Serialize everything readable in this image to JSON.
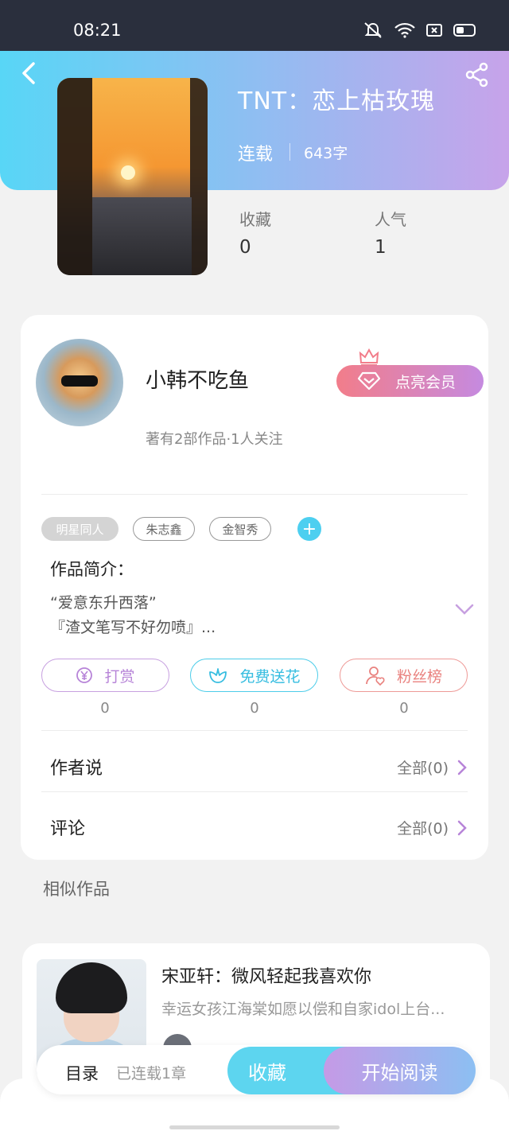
{
  "status_bar": {
    "time": "08:21"
  },
  "book": {
    "title": "TNT：恋上枯玫瑰",
    "status": "连载",
    "word_count": "643字",
    "stats": [
      {
        "label": "收藏",
        "value": "0"
      },
      {
        "label": "人气",
        "value": "1"
      }
    ]
  },
  "author": {
    "name": "小韩不吃鱼",
    "meta": "著有2部作品·1人关注",
    "vip_label": "点亮会员"
  },
  "tags": [
    "明星同人",
    "朱志鑫",
    "金智秀"
  ],
  "intro": {
    "title": "作品简介：",
    "lines": [
      "“爱意东升西落”",
      "『渣文笔写不好勿喷』..."
    ]
  },
  "actions": [
    {
      "label": "打赏",
      "count": "0"
    },
    {
      "label": "免费送花",
      "count": "0"
    },
    {
      "label": "粉丝榜",
      "count": "0"
    }
  ],
  "rows": [
    {
      "label": "作者说",
      "link": "全部(0)"
    },
    {
      "label": "评论",
      "link": "全部(0)"
    }
  ],
  "similar": {
    "title": "相似作品",
    "items": [
      {
        "title": "宋亚轩：微风轻起我喜欢你",
        "desc": "幸运女孩江海棠如愿以偿和自家idol上台..."
      }
    ]
  },
  "bottom": {
    "toc": "目录",
    "chapters": "已连载1章",
    "collect": "收藏",
    "read": "开始阅读"
  },
  "colors": {
    "header_start": "#58d6f6",
    "header_end": "#c7a3ea",
    "accent_cyan": "#4dcff0",
    "accent_purple": "#b784d8",
    "accent_red": "#e9827f"
  }
}
